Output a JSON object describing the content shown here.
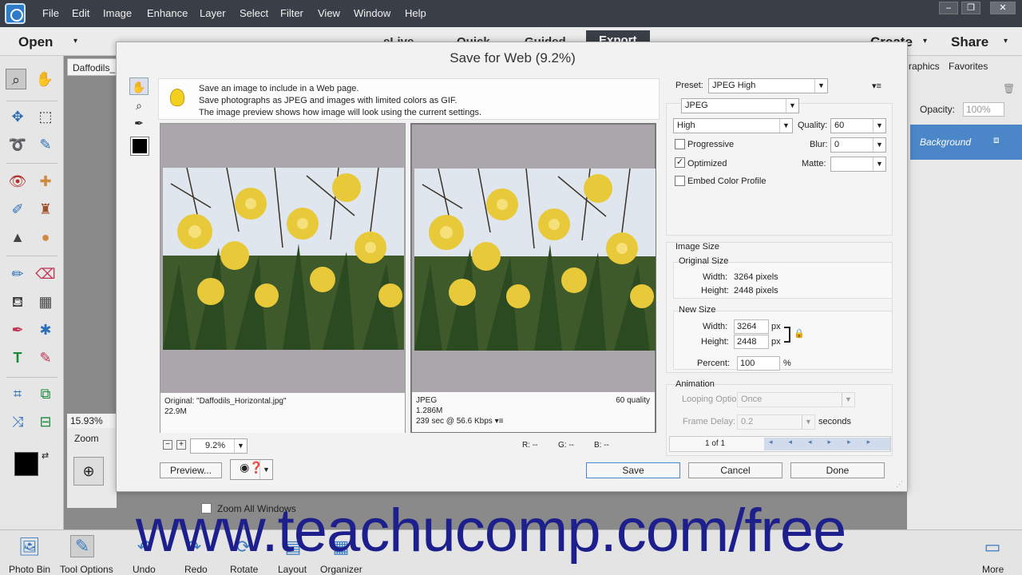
{
  "menubar": {
    "items": [
      "File",
      "Edit",
      "Image",
      "Enhance",
      "Layer",
      "Select",
      "Filter",
      "View",
      "Window",
      "Help"
    ]
  },
  "modebar": {
    "open": "Open",
    "tabs": [
      "eLive",
      "Quick",
      "Guided",
      "Export"
    ],
    "create": "Create",
    "share": "Share"
  },
  "doc": {
    "tab": "Daffodils_",
    "zoom": "15.93%",
    "zoom_panel_label": "Zoom"
  },
  "rightpanel": {
    "tabs": [
      "raphics",
      "Favorites"
    ],
    "opacity_label": "Opacity:",
    "opacity_value": "100%",
    "layer": "Background"
  },
  "bottombar": {
    "items": [
      "Photo Bin",
      "Tool Options",
      "Undo",
      "Redo",
      "Rotate",
      "Layout",
      "Organizer",
      "More"
    ],
    "zoom_all": "Zoom All Windows"
  },
  "dialog": {
    "title": "Save for Web (9.2%)",
    "tips": [
      "Save an image to include in a Web page.",
      "Save photographs as JPEG and images with limited colors as GIF.",
      "The image preview shows how image will look using the current settings."
    ],
    "original": {
      "name": "Original: \"Daffodils_Horizontal.jpg\"",
      "size": "22.9M"
    },
    "optimized": {
      "format": "JPEG",
      "size": "1.286M",
      "time": "239 sec @ 56.6 Kbps",
      "quality": "60 quality"
    },
    "zoom": "9.2%",
    "readout": {
      "r": "R: --",
      "g": "G: --",
      "b": "B: --"
    },
    "preset_label": "Preset:",
    "preset": "JPEG High",
    "format": "JPEG",
    "quality_level": "High",
    "quality_label": "Quality:",
    "quality": "60",
    "progressive": "Progressive",
    "blur_label": "Blur:",
    "blur": "0",
    "optimized_label": "Optimized",
    "matte_label": "Matte:",
    "embed": "Embed Color Profile",
    "image_size": "Image Size",
    "original_size": "Original Size",
    "orig_width_label": "Width:",
    "orig_width": "3264 pixels",
    "orig_height_label": "Height:",
    "orig_height": "2448 pixels",
    "new_size": "New Size",
    "new_width_label": "Width:",
    "new_width": "3264",
    "new_height_label": "Height:",
    "new_height": "2448",
    "px": "px",
    "percent_label": "Percent:",
    "percent": "100",
    "percent_unit": "%",
    "animation": "Animation",
    "looping_label": "Looping Options:",
    "looping": "Once",
    "delay_label": "Frame Delay:",
    "delay": "0.2",
    "seconds": "seconds",
    "frames": "1 of 1",
    "buttons": {
      "preview": "Preview...",
      "save": "Save",
      "cancel": "Cancel",
      "done": "Done"
    }
  },
  "watermark": "www.teachucomp.com/free"
}
